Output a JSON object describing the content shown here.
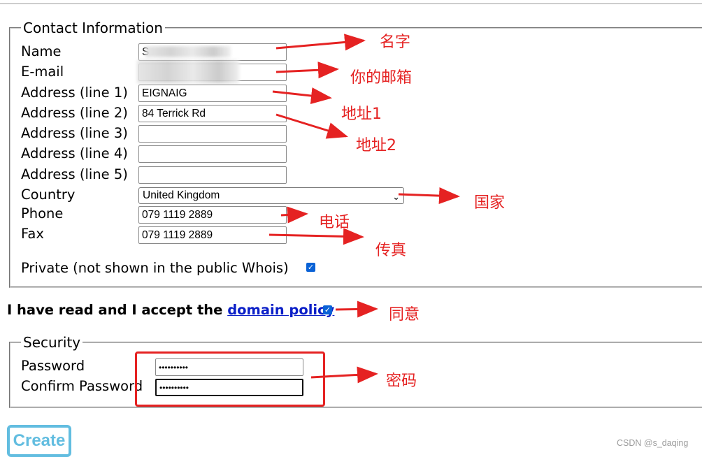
{
  "contact": {
    "legend": "Contact Information",
    "fields": [
      {
        "label": "Name",
        "value": "S"
      },
      {
        "label": "E-mail",
        "value": ""
      },
      {
        "label": "Address (line 1)",
        "value": "EIGNAIG"
      },
      {
        "label": "Address (line 2)",
        "value": "84 Terrick Rd"
      },
      {
        "label": "Address (line 3)",
        "value": ""
      },
      {
        "label": "Address (line 4)",
        "value": ""
      },
      {
        "label": "Address (line 5)",
        "value": ""
      }
    ],
    "country": {
      "label": "Country",
      "value": "United Kingdom",
      "chevron": "⌄"
    },
    "phone": {
      "label": "Phone",
      "value": "079 1119 2889"
    },
    "fax": {
      "label": "Fax",
      "value": "079 1119 2889"
    },
    "private": {
      "label": "Private (not shown in the public Whois)",
      "checked": true
    }
  },
  "policy": {
    "prefix": "I have read and I accept the ",
    "link": "domain policy",
    "checked": true
  },
  "security": {
    "legend": "Security",
    "password": {
      "label": "Password",
      "value": "••••••••••"
    },
    "confirm": {
      "label": "Confirm Password",
      "value": "••••••••••"
    }
  },
  "create_button": "Create",
  "annotations": {
    "name": "名字",
    "email": "你的邮箱",
    "address1": "地址1",
    "address2": "地址2",
    "country": "国家",
    "phone": "电话",
    "fax": "传真",
    "agree": "同意",
    "password": "密码"
  },
  "watermark": "CSDN @s_daqing",
  "colors": {
    "annotation": "#e52222",
    "checkbox": "#0a62d6",
    "link": "#0b1fc7",
    "create_button": "#62bde0"
  },
  "icons": {
    "checkbox": "check-icon",
    "dropdown": "chevron-down-icon"
  }
}
